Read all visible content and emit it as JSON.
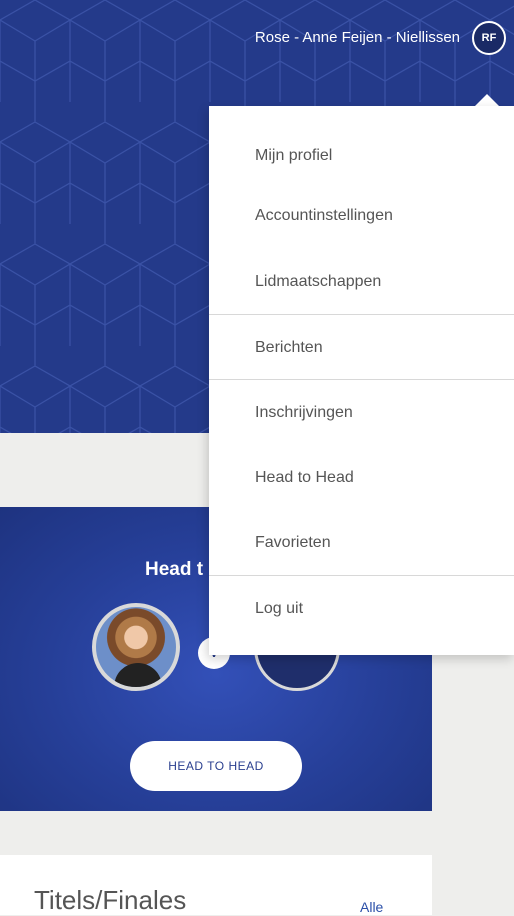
{
  "header": {
    "user_name": "Rose - Anne Feijen - Niellissen",
    "avatar_initials": "RF"
  },
  "menu": {
    "items": [
      {
        "label": "Mijn profiel"
      },
      {
        "label": "Accountinstellingen"
      },
      {
        "label": "Lidmaatschappen"
      },
      {
        "label": "Berichten"
      },
      {
        "label": "Inschrijvingen"
      },
      {
        "label": "Head to Head"
      },
      {
        "label": "Favorieten"
      },
      {
        "label": "Log uit"
      }
    ]
  },
  "head_to_head": {
    "title": "Head t",
    "vs_label": "V",
    "button_label": "HEAD TO HEAD"
  },
  "titels": {
    "title": "Titels/Finales",
    "link_label": "Alle"
  },
  "colors": {
    "brand_blue": "#243a8a",
    "menu_text": "#555555",
    "link_blue": "#2a4fa8"
  }
}
